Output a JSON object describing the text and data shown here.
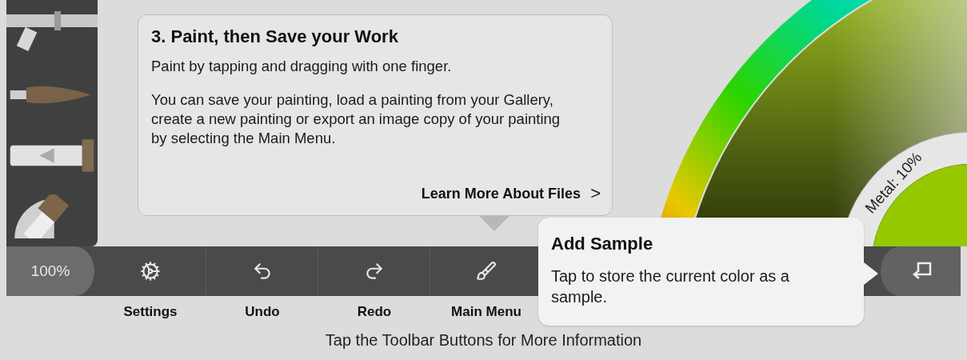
{
  "help_card": {
    "title": "3. Paint, then Save your Work",
    "paragraphs": [
      "Paint by tapping and dragging with one finger.",
      "You can save your painting, load a painting from your Gallery, create a new painting or export an image copy of your painting by selecting the Main Menu."
    ],
    "link": "Learn More About Files",
    "link_arrow": ">"
  },
  "color_picker": {
    "metal_label": "Metal: 10%"
  },
  "toolbar": {
    "zoom": "100%",
    "buttons": [
      {
        "label": "Settings"
      },
      {
        "label": "Undo"
      },
      {
        "label": "Redo"
      },
      {
        "label": "Main Menu"
      }
    ]
  },
  "tooltip": {
    "title": "Add Sample",
    "text": "Tap to store the current color as a sample."
  },
  "hint": "Tap the Toolbar Buttons for More Information"
}
